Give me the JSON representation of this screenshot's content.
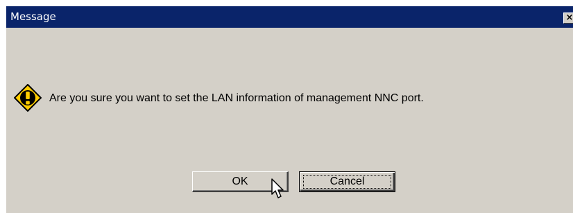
{
  "window": {
    "title": "Message",
    "close_glyph": "×"
  },
  "message": {
    "icon": "warning-icon",
    "text": "Are you sure you want to set the LAN information of management NNC port."
  },
  "buttons": {
    "ok_label": "OK",
    "cancel_label": "Cancel"
  },
  "colors": {
    "titlebar": "#0a246a",
    "dialog_face": "#d4d0c8",
    "warning_fill": "#ffcc00"
  }
}
